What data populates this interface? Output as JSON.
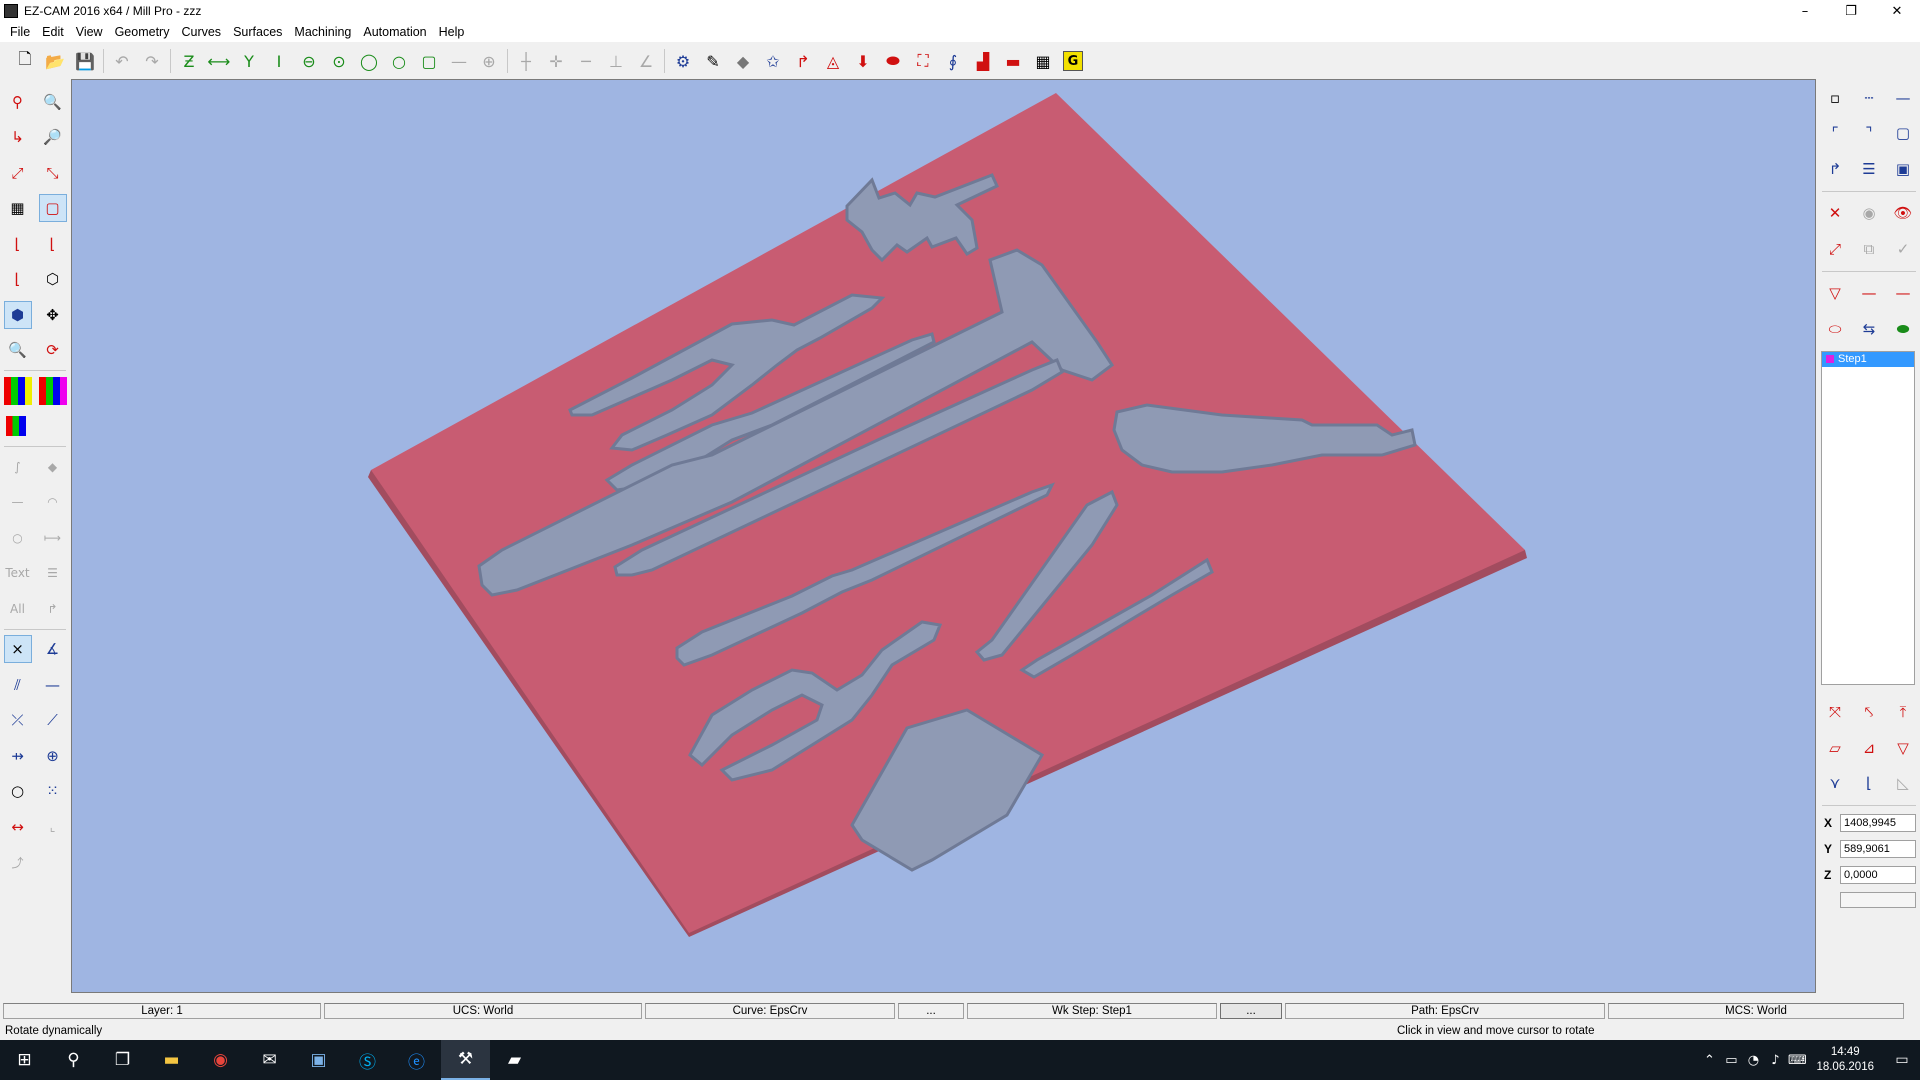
{
  "window": {
    "title": "EZ-CAM 2016 x64 / Mill Pro  - zzz",
    "minimize": "–",
    "restore": "❐",
    "close": "✕"
  },
  "menu": [
    "File",
    "Edit",
    "View",
    "Geometry",
    "Curves",
    "Surfaces",
    "Machining",
    "Automation",
    "Help"
  ],
  "toolbar_icons": [
    "new-file-icon",
    "open-folder-icon",
    "save-icon",
    "undo-icon",
    "redo-icon",
    "line-z-icon",
    "line-horizontal-icon",
    "line-y-icon",
    "line-vertical-icon",
    "circle-icon",
    "circle-center-icon",
    "circle-tangent-icon",
    "circle-3pt-icon",
    "rectangle-icon",
    "line-dashed-icon",
    "crosshair-icon",
    "point-horizontal-icon",
    "point-cross-icon",
    "point-line-icon",
    "dimension-vertical-icon",
    "dimension-angle-icon",
    "machine-icon",
    "wand-icon",
    "eraser-icon",
    "star-icon",
    "toolpath-arc-icon",
    "offset-icon",
    "download-red-icon",
    "pocket-icon",
    "contour-icon",
    "drill-icon",
    "tool-icon",
    "simulate-icon",
    "table-icon",
    "gcode-icon"
  ],
  "left_tools": [
    "Text",
    "All"
  ],
  "viewport": {
    "background": "#9fb5e2",
    "plate_color": "#c85c72",
    "pocket_color": "#8f9ab4"
  },
  "steps": [
    {
      "label": "Step1"
    }
  ],
  "coords": {
    "x_label": "X",
    "x_value": "1408,9945",
    "y_label": "Y",
    "y_value": "589,9061",
    "z_label": "Z",
    "z_value": "0,0000"
  },
  "status": {
    "layer": "Layer: 1",
    "ucs": "UCS: World",
    "curve": "Curve: EpsCrv",
    "curve_btn": "...",
    "wkstep": "Wk Step: Step1",
    "wkstep_btn": "...",
    "path": "Path: EpsCrv",
    "mcs": "MCS: World"
  },
  "hint": {
    "left": "Rotate dynamically",
    "right": "Click in view and move cursor to rotate"
  },
  "taskbar": {
    "time": "14:49",
    "date": "18.06.2016"
  }
}
